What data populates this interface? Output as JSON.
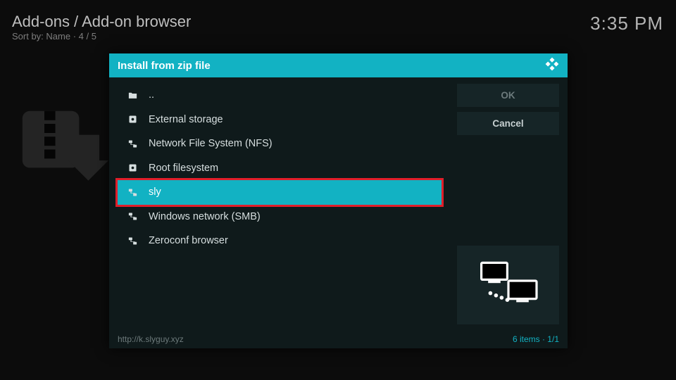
{
  "header": {
    "breadcrumb": "Add-ons / Add-on browser",
    "sort_line": "Sort by: Name  ·  4 / 5",
    "clock": "3:35 PM"
  },
  "dialog": {
    "title": "Install from zip file",
    "footer_path": "http://k.slyguy.xyz",
    "footer_count": "6 items · 1/1",
    "buttons": {
      "ok": "OK",
      "cancel": "Cancel"
    },
    "items": [
      {
        "icon": "folder-up",
        "label": ".."
      },
      {
        "icon": "disk",
        "label": "External storage"
      },
      {
        "icon": "network",
        "label": "Network File System (NFS)"
      },
      {
        "icon": "disk",
        "label": "Root filesystem"
      },
      {
        "icon": "network",
        "label": "sly"
      },
      {
        "icon": "network",
        "label": "Windows network (SMB)"
      },
      {
        "icon": "network",
        "label": "Zeroconf browser"
      }
    ],
    "selected_index": 4
  }
}
